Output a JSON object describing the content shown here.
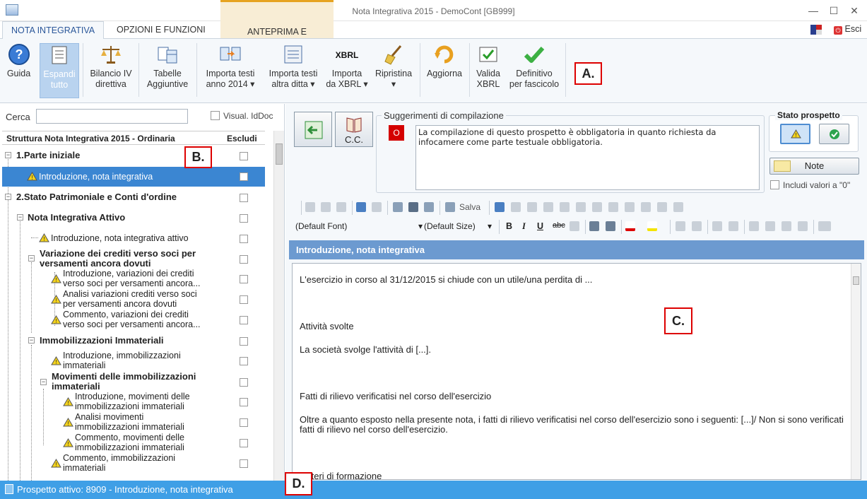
{
  "window": {
    "title": "Nota Integrativa 2015 - DemoCont [GB999]",
    "minimize": "—",
    "maximize": "☐",
    "close": "✕"
  },
  "tabs": [
    {
      "label": "NOTA INTEGRATIVA",
      "active": true
    },
    {
      "label": "OPZIONI E FUNZIONI",
      "active": false
    },
    {
      "label": "ANTEPRIMA E STAMPA",
      "active": false
    }
  ],
  "esci_label": "Esci",
  "ribbon": {
    "guida": "Guida",
    "espandi_1": "Espandi",
    "espandi_2": "tutto",
    "bilancio_1": "Bilancio IV",
    "bilancio_2": "direttiva",
    "tabelle_1": "Tabelle",
    "tabelle_2": "Aggiuntive",
    "importa_anno_1": "Importa testi",
    "importa_anno_2": "anno 2014 ▾",
    "importa_ditta_1": "Importa testi",
    "importa_ditta_2": "altra ditta ▾",
    "importa_xbrl_1": "Importa",
    "importa_xbrl_2": "da XBRL ▾",
    "ripristina_1": "Ripristina",
    "ripristina_2": "▾",
    "aggiorna": "Aggiorna",
    "valida_1": "Valida",
    "valida_2": "XBRL",
    "definitivo_1": "Definitivo",
    "definitivo_2": "per fascicolo"
  },
  "markers": {
    "a": "A.",
    "b": "B.",
    "c": "C.",
    "d": "D."
  },
  "search": {
    "label": "Cerca",
    "value": "",
    "visual_label": "Visual. IdDoc"
  },
  "tree": {
    "header_title": "Struttura Nota Integrativa 2015 - Ordinaria",
    "header_excl": "Escludi",
    "rows": [
      {
        "l1": "1.Parte iniziale",
        "l2": ""
      },
      {
        "l1": "Introduzione, nota integrativa",
        "l2": ""
      },
      {
        "l1": "2.Stato Patrimoniale e Conti d'ordine",
        "l2": ""
      },
      {
        "l1": "Nota Integrativa Attivo",
        "l2": ""
      },
      {
        "l1": "Introduzione, nota integrativa attivo",
        "l2": ""
      },
      {
        "l1": "Variazione dei crediti verso soci per",
        "l2": "versamenti ancora dovuti"
      },
      {
        "l1": "Introduzione, variazioni dei crediti",
        "l2": "verso soci per versamenti ancora..."
      },
      {
        "l1": "Analisi variazioni crediti verso soci",
        "l2": "per versamenti ancora dovuti"
      },
      {
        "l1": "Commento, variazioni dei crediti",
        "l2": "verso soci per versamenti ancora..."
      },
      {
        "l1": "Immobilizzazioni Immateriali",
        "l2": ""
      },
      {
        "l1": "Introduzione, immobilizzazioni",
        "l2": "immateriali"
      },
      {
        "l1": "Movimenti delle immobilizzazioni",
        "l2": "immateriali"
      },
      {
        "l1": "Introduzione, movimenti delle",
        "l2": "immobilizzazioni immateriali"
      },
      {
        "l1": "Analisi movimenti",
        "l2": "immobilizzazioni immateriali"
      },
      {
        "l1": "Commento, movimenti delle",
        "l2": "immobilizzazioni immateriali"
      },
      {
        "l1": "Commento, immobilizzazioni",
        "l2": "immateriali"
      }
    ]
  },
  "right": {
    "cc_label": "C.C.",
    "sugg_title": "Suggerimenti di compilazione",
    "sugg_badge": "O",
    "sugg_text": "La compilazione di questo prospetto è obbligatoria in quanto richiesta da infocamere come parte testuale obbligatoria.",
    "stato_title": "Stato prospetto",
    "note_label": "Note",
    "includi_label": "Includi valori a \"0\""
  },
  "toolbar": {
    "salva": "Salva",
    "font": "(Default Font)",
    "size": "(Default Size)",
    "bold": "B",
    "italic": "I",
    "underline": "U",
    "strike": "abc"
  },
  "editor": {
    "title": "Introduzione, nota integrativa",
    "paragraphs": [
      "L'esercizio in corso al 31/12/2015 si chiude con un utile/una perdita di ...",
      "Attività svolte",
      "La società svolge l'attività di [...].",
      "Fatti di rilievo verificatisi nel corso dell'esercizio",
      "Oltre a quanto esposto nella presente nota, i fatti di rilievo verificatisi nel corso dell'esercizio sono i seguenti: [...]/ Non si sono verificati fatti di rilievo nel corso dell'esercizio.",
      "Criteri di formazione"
    ]
  },
  "status": {
    "text": "Prospetto attivo: 8909 - Introduzione, nota integrativa"
  },
  "colors": {
    "accent": "#3f9fe6",
    "selection": "#3b86d2",
    "marker": "#dd0000",
    "header": "#6c9ad0"
  }
}
